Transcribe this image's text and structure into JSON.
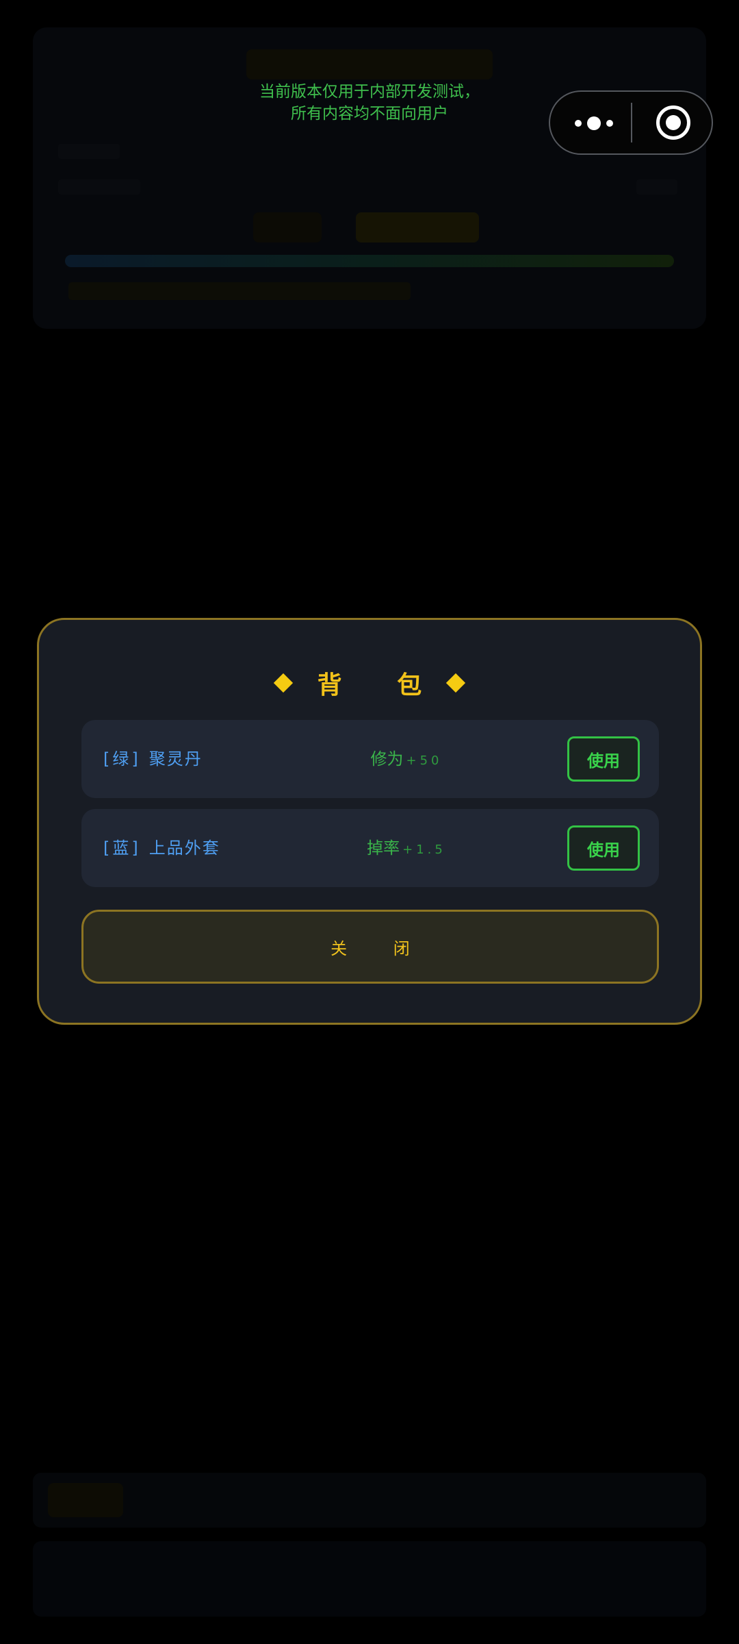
{
  "dev_notice": {
    "line1": "当前版本仅用于内部开发测试，",
    "line2": "所有内容均不面向用户"
  },
  "capsule": {
    "more_icon": "more-dots-icon",
    "close_icon": "target-close-icon"
  },
  "backpack": {
    "title": "背 包",
    "items": [
      {
        "grade": "[绿]",
        "name": "聚灵丹",
        "effect_label": "修为",
        "effect_value": "+50",
        "use_label": "使用"
      },
      {
        "grade": "[蓝]",
        "name": "上品外套",
        "effect_label": "掉率",
        "effect_value": "+1.5",
        "use_label": "使用"
      }
    ],
    "close_label": "关 闭"
  },
  "colors": {
    "accent_gold": "#f2c21a",
    "item_blue": "#4f9ff2",
    "effect_green": "#3ab44a",
    "modal_bg": "#181c24"
  }
}
